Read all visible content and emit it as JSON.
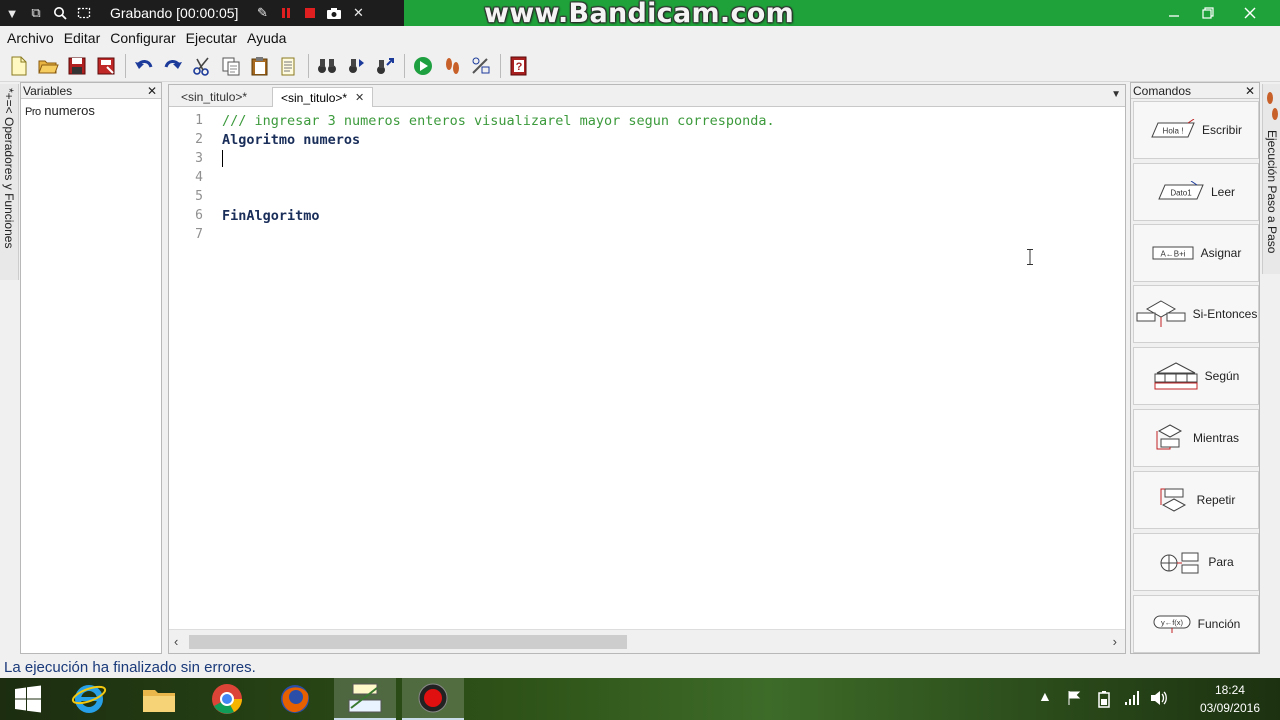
{
  "recorder": {
    "status": "Grabando [00:00:05]",
    "watermark": "www.Bandicam.com"
  },
  "menu": [
    "Archivo",
    "Editar",
    "Configurar",
    "Ejecutar",
    "Ayuda"
  ],
  "left_strip": {
    "label": "Operadores y Funciones",
    "symbols": "*+=<"
  },
  "variables": {
    "title": "Variables",
    "items": [
      {
        "badge": "Pro",
        "label": "numeros"
      }
    ]
  },
  "editor": {
    "tabs": [
      {
        "label": "<sin_titulo>*",
        "active": false
      },
      {
        "label": "<sin_titulo>*",
        "active": true
      }
    ],
    "lines": [
      {
        "n": "1",
        "text": "/// ingresar 3 numeros enteros visualizarel mayor segun corresponda.",
        "kind": "comment"
      },
      {
        "n": "2",
        "text": "Algoritmo numeros",
        "kind": "keyword"
      },
      {
        "n": "3",
        "text": "",
        "kind": "plain"
      },
      {
        "n": "4",
        "text": "",
        "kind": "plain"
      },
      {
        "n": "5",
        "text": "",
        "kind": "plain"
      },
      {
        "n": "6",
        "text": "FinAlgoritmo",
        "kind": "keyword"
      },
      {
        "n": "7",
        "text": "",
        "kind": "plain"
      }
    ]
  },
  "commands": {
    "title": "Comandos",
    "items": [
      {
        "label": "Escribir",
        "icon": "hola-parallelogram-icon",
        "glyph": "Hola !"
      },
      {
        "label": "Leer",
        "icon": "dato-parallelogram-icon",
        "glyph": "Dato1"
      },
      {
        "label": "Asignar",
        "icon": "assign-box-icon",
        "glyph": "A←B+i"
      },
      {
        "label": "Si-Entonces",
        "icon": "decision-diamond-icon"
      },
      {
        "label": "Según",
        "icon": "switch-structure-icon"
      },
      {
        "label": "Mientras",
        "icon": "while-loop-icon"
      },
      {
        "label": "Repetir",
        "icon": "repeat-loop-icon"
      },
      {
        "label": "Para",
        "icon": "for-loop-icon"
      },
      {
        "label": "Función",
        "icon": "function-icon",
        "glyph": "y←f(x)"
      }
    ]
  },
  "right_strip": {
    "label": "Ejecución Paso a Paso"
  },
  "status": {
    "message": "La ejecución ha finalizado sin errores."
  },
  "taskbar": {
    "time": "18:24",
    "date": "03/09/2016"
  },
  "colors": {
    "titlebar": "#1fa23a",
    "comment": "#3c9a3c",
    "keyword": "#1a2e5a",
    "status_text": "#1a3a7a"
  }
}
